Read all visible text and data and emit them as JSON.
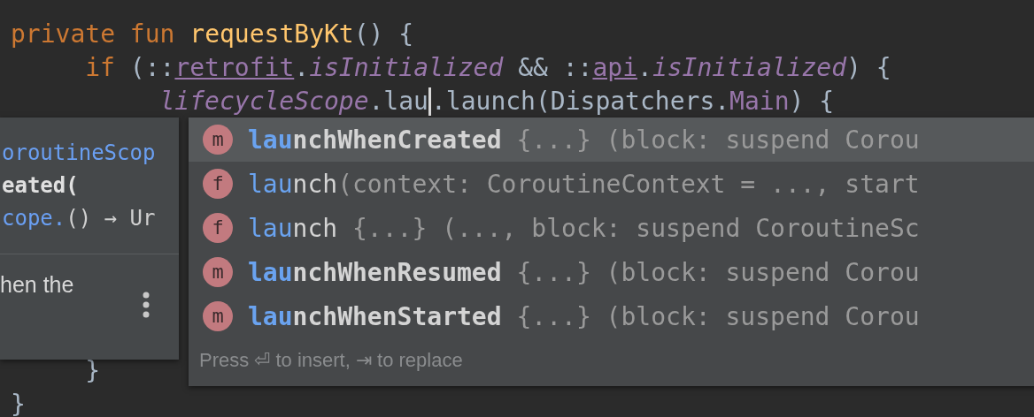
{
  "editor": {
    "lines": [
      {
        "tokens": [
          {
            "kind": "keyword",
            "text": "private "
          },
          {
            "kind": "keyword",
            "text": "fun "
          },
          {
            "kind": "function",
            "text": "requestByKt"
          },
          {
            "kind": "plain",
            "text": "() {"
          }
        ]
      },
      {
        "tokens": [
          {
            "kind": "keyword",
            "text": "if "
          },
          {
            "kind": "plain",
            "text": "(::"
          },
          {
            "kind": "property",
            "text": "retrofit"
          },
          {
            "kind": "plain",
            "text": "."
          },
          {
            "kind": "extension",
            "text": "isInitialized"
          },
          {
            "kind": "plain",
            "text": " && ::"
          },
          {
            "kind": "property",
            "text": "api"
          },
          {
            "kind": "plain",
            "text": "."
          },
          {
            "kind": "extension",
            "text": "isInitialized"
          },
          {
            "kind": "plain",
            "text": ") {"
          }
        ]
      },
      {
        "tokens": [
          {
            "kind": "extension",
            "text": "lifecycleScope"
          },
          {
            "kind": "plain",
            "text": ".lau"
          },
          {
            "kind": "caret"
          },
          {
            "kind": "plain",
            "text": ".launch(Dispatchers."
          },
          {
            "kind": "constant",
            "text": "Main"
          },
          {
            "kind": "plain",
            "text": ") {"
          }
        ]
      }
    ],
    "closing_lines": [
      "}",
      "}"
    ]
  },
  "documentation_popup": {
    "signature": [
      {
        "tokens": [
          {
            "kind": "type",
            "text": "oroutineScop"
          }
        ]
      },
      {
        "tokens": [
          {
            "kind": "name",
            "text": "eated("
          }
        ]
      },
      {
        "tokens": [
          {
            "kind": "type",
            "text": "cope."
          },
          {
            "kind": "plain",
            "text": "() → Ur"
          }
        ]
      }
    ],
    "description": "hen the"
  },
  "completion_popup": {
    "items": [
      {
        "kind": "method",
        "icon_letter": "m",
        "match": "lau",
        "rest": "nchWhenCreated",
        "detail": " {...} (block: suspend Corou",
        "selected": true
      },
      {
        "kind": "function",
        "icon_letter": "f",
        "match": "lau",
        "rest": "nch",
        "detail": "(context: CoroutineContext = ..., start",
        "selected": false
      },
      {
        "kind": "function",
        "icon_letter": "f",
        "match": "lau",
        "rest": "nch",
        "detail": " {...} (..., block: suspend CoroutineSc",
        "selected": false
      },
      {
        "kind": "method",
        "icon_letter": "m",
        "match": "lau",
        "rest": "nchWhenResumed",
        "detail": " {...} (block: suspend Corou",
        "selected": false
      },
      {
        "kind": "method",
        "icon_letter": "m",
        "match": "lau",
        "rest": "nchWhenStarted",
        "detail": " {...} (block: suspend Corou",
        "selected": false
      }
    ],
    "hint": "Press ⏎ to insert, ⇥ to replace"
  }
}
